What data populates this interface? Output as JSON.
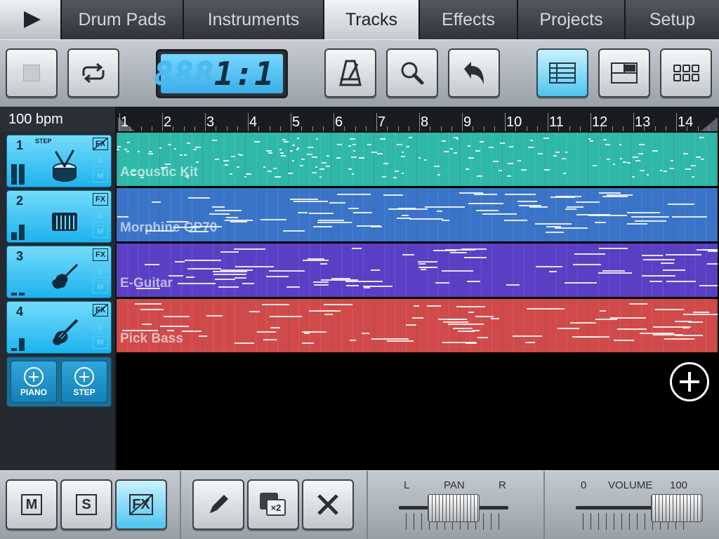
{
  "tabs": {
    "play_label": "▶",
    "items": [
      "Drum Pads",
      "Instruments",
      "Tracks",
      "Effects",
      "Projects",
      "Setup"
    ],
    "active": "Tracks"
  },
  "toolbar": {
    "position_display": "1:1",
    "position_ghost": "888",
    "buttons": [
      "stop-icon",
      "loop-icon",
      "metronome-icon",
      "zoom-icon",
      "undo-icon",
      "track-list-icon",
      "split-view-icon",
      "grid-view-icon"
    ]
  },
  "tempo": {
    "bpm_label": "100 bpm"
  },
  "ruler": {
    "bars": [
      "1",
      "2",
      "3",
      "4",
      "5",
      "6",
      "7",
      "8",
      "9",
      "10",
      "11",
      "12",
      "13",
      "14"
    ]
  },
  "tracks": [
    {
      "number": "1",
      "step_label": "STEP",
      "name": "Acoustic Kit",
      "fx": "FX",
      "solo": "S",
      "mute": "M",
      "color": "#2fb8a8",
      "icon": "drum-icon",
      "meter": [
        0.8,
        0.8
      ],
      "fx_bypassed": true
    },
    {
      "number": "2",
      "step_label": "",
      "name": "Morphine CP70",
      "fx": "FX",
      "solo": "S",
      "mute": "M",
      "color": "#3a74c8",
      "icon": "keyboard-icon",
      "meter": [
        0.3,
        0.6
      ],
      "fx_bypassed": false
    },
    {
      "number": "3",
      "step_label": "",
      "name": "E-Guitar",
      "fx": "FX",
      "solo": "S",
      "mute": "M",
      "color": "#5a3fc4",
      "icon": "guitar-icon",
      "meter": [
        0.1,
        0.1
      ],
      "fx_bypassed": false
    },
    {
      "number": "4",
      "step_label": "",
      "name": "Pick Bass",
      "fx": "FX",
      "solo": "S",
      "mute": "M",
      "color": "#d04a4a",
      "icon": "bass-icon",
      "meter": [
        0.1,
        0.5
      ],
      "fx_bypassed": true
    }
  ],
  "add": {
    "piano_label": "PIANO",
    "step_label": "STEP"
  },
  "bottom": {
    "mute_label": "M",
    "solo_label": "S",
    "fx_label": "FX",
    "duplicate_label": "×2",
    "pan": {
      "left": "L",
      "title": "PAN",
      "right": "R",
      "value": 0.5
    },
    "volume": {
      "min": "0",
      "title": "VOLUME",
      "max": "100",
      "value": 0.82
    }
  }
}
